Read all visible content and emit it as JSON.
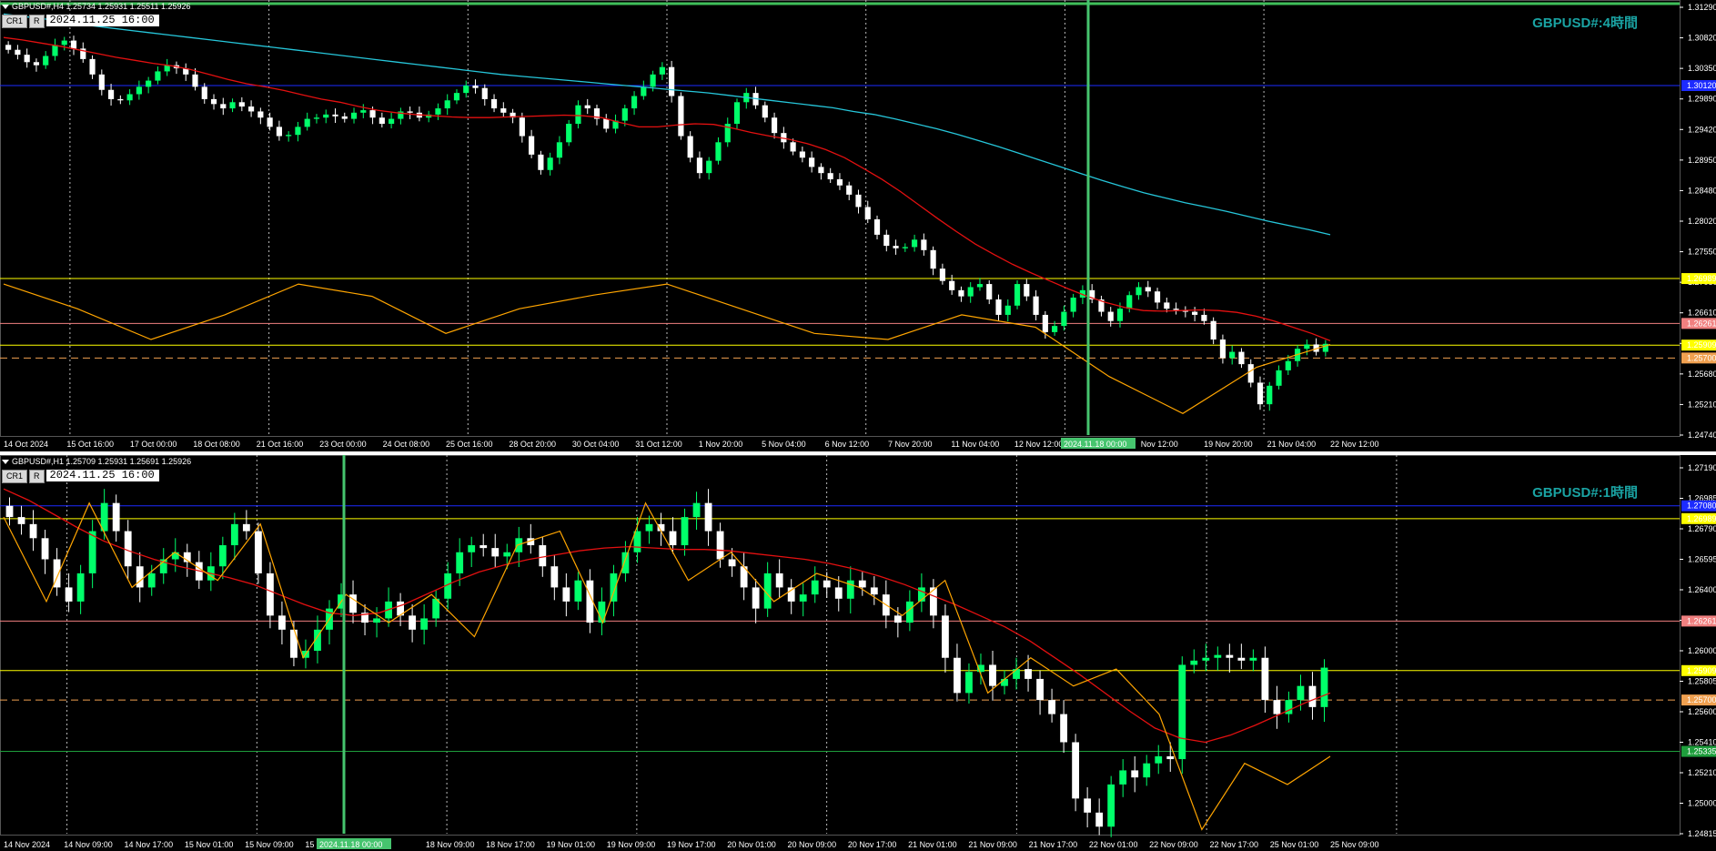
{
  "colors": {
    "background": "#000000",
    "axis_text": "#ffffff",
    "bull": "#00ff6a",
    "bear": "#ffffff",
    "ma_red": "#e31010",
    "ma_cyan": "#26c6da",
    "zigzag": "#ffa500",
    "blue_line": "#1c2bff",
    "yellow_line": "#ffff00",
    "pink_line": "#f08080",
    "orange_dash": "#f0a050",
    "green_line": "#1e9e3c",
    "crosshair": "#46c46e",
    "title": "#1aa3a3"
  },
  "panels": [
    {
      "id": "h4",
      "header": "GBPUSD#,H4  1.25734 1.25931 1.25511 1.25926",
      "cr_label": "CR1",
      "r_label": "R",
      "date_value": "2024.11.25 16:00",
      "title": "GBPUSD#:4時間",
      "crosshair_label": "2024.11.18 00:00",
      "chart_data": {
        "type": "candlestick",
        "ylim": [
          1.2445,
          1.3139
        ],
        "y_ticks": [
          "1.31290",
          "1.30820",
          "1.30350",
          "1.29890",
          "1.29420",
          "1.28950",
          "1.28480",
          "1.28020",
          "1.27550",
          "1.27080",
          "1.26610",
          "1.26150",
          "1.25680",
          "1.25210",
          "1.24740"
        ],
        "x_ticks": [
          "14 Oct 2024",
          "15 Oct 16:00",
          "17 Oct 00:00",
          "18 Oct 08:00",
          "21 Oct 16:00",
          "23 Oct 00:00",
          "24 Oct 08:00",
          "25 Oct 16:00",
          "28 Oct 20:00",
          "30 Oct 04:00",
          "31 Oct 12:00",
          "1 Nov 20:00",
          "5 Nov 04:00",
          "6 Nov 12:00",
          "7 Nov 20:00",
          "11 Nov 04:00",
          "12 Nov 12:00",
          "13 Nov 20:00",
          "Nov 12:00",
          "19 Nov 20:00",
          "21 Nov 04:00",
          "22 Nov 12:00"
        ],
        "closes": [
          1.307,
          1.3062,
          1.305,
          1.3045,
          1.306,
          1.3078,
          1.3085,
          1.3072,
          1.3055,
          1.303,
          1.3005,
          1.299,
          1.2988,
          1.2998,
          1.301,
          1.302,
          1.3035,
          1.3045,
          1.304,
          1.303,
          1.301,
          1.299,
          1.2982,
          1.2975,
          1.2985,
          1.2978,
          1.297,
          1.296,
          1.2945,
          1.293,
          1.2932,
          1.2945,
          1.2958,
          1.296,
          1.2965,
          1.2962,
          1.2958,
          1.2968,
          1.2972,
          1.296,
          1.295,
          1.2958,
          1.297,
          1.2968,
          1.296,
          1.2965,
          1.2975,
          1.2988,
          1.3,
          1.3012,
          1.3008,
          1.299,
          1.2975,
          1.2968,
          1.296,
          1.293,
          1.29,
          1.2875,
          1.2895,
          1.292,
          1.295,
          1.298,
          1.2975,
          1.2958,
          1.2942,
          1.2955,
          1.2975,
          1.2995,
          1.301,
          1.303,
          1.3042,
          1.2995,
          1.293,
          1.2895,
          1.287,
          1.289,
          1.292,
          1.295,
          1.2985,
          1.3,
          1.298,
          1.296,
          1.2935,
          1.292,
          1.2905,
          1.2895,
          1.288,
          1.287,
          1.286,
          1.285,
          1.2835,
          1.2815,
          1.2795,
          1.277,
          1.2752,
          1.2748,
          1.275,
          1.2762,
          1.2745,
          1.2715,
          1.2695,
          1.268,
          1.267,
          1.2685,
          1.269,
          1.2665,
          1.264,
          1.2655,
          1.269,
          1.267,
          1.264,
          1.2612,
          1.2622,
          1.2645,
          1.2668,
          1.268,
          1.2665,
          1.2645,
          1.263,
          1.265,
          1.2672,
          1.2685,
          1.2678,
          1.266,
          1.265,
          1.2648,
          1.2645,
          1.264,
          1.263,
          1.26,
          1.257,
          1.258,
          1.256,
          1.253,
          1.2495,
          1.2525,
          1.255,
          1.2565,
          1.2585,
          1.2592,
          1.258,
          1.2593
        ],
        "series": [
          {
            "name": "",
            "color": "#e31010",
            "values": [
              1.309,
              1.3086,
              1.3081,
              1.3076,
              1.307,
              1.3064,
              1.3058,
              1.3053,
              1.3048,
              1.3044,
              1.3038,
              1.303,
              1.3022,
              1.3015,
              1.301,
              1.3004,
              1.2997,
              1.299,
              1.2985,
              1.2978,
              1.2972,
              1.2968,
              1.2965,
              1.2963,
              1.2961,
              1.296,
              1.296,
              1.2961,
              1.2962,
              1.2963,
              1.2964,
              1.2963,
              1.296,
              1.2952,
              1.2945,
              1.2945,
              1.2948,
              1.295,
              1.2949,
              1.2943,
              1.2936,
              1.293,
              1.2925,
              1.2918,
              1.2908,
              1.2895,
              1.2878,
              1.286,
              1.284,
              1.2818,
              1.2796,
              1.2775,
              1.2755,
              1.2738,
              1.2722,
              1.2708,
              1.2695,
              1.2682,
              1.267,
              1.266,
              1.2652,
              1.2647,
              1.2646,
              1.2647,
              1.2648,
              1.2647,
              1.2644,
              1.2638,
              1.263,
              1.262,
              1.261,
              1.2598
            ]
          },
          {
            "name": "",
            "color": "#26c6da",
            "values": [
              1.3128,
              1.3124,
              1.312,
              1.3115,
              1.311,
              1.3106,
              1.3102,
              1.3098,
              1.3094,
              1.309,
              1.3086,
              1.3082,
              1.3078,
              1.3074,
              1.307,
              1.3066,
              1.3062,
              1.3058,
              1.3054,
              1.305,
              1.3046,
              1.3042,
              1.3038,
              1.3034,
              1.303,
              1.3027,
              1.3024,
              1.3021,
              1.3018,
              1.3015,
              1.3012,
              1.3009,
              1.3006,
              1.3003,
              1.3,
              1.2996,
              1.2992,
              1.2988,
              1.2984,
              1.298,
              1.2976,
              1.297,
              1.2965,
              1.2958,
              1.295,
              1.2942,
              1.2933,
              1.2923,
              1.2913,
              1.2902,
              1.2891,
              1.288,
              1.2869,
              1.2858,
              1.2848,
              1.2838,
              1.283,
              1.2822,
              1.2815,
              1.2808,
              1.28,
              1.2792,
              1.2785,
              1.2778,
              1.277
            ]
          },
          {
            "name": "",
            "color": "#ffa500",
            "values": [
              1.269,
              1.265,
              1.26,
              1.264,
              1.269,
              1.267,
              1.261,
              1.265,
              1.2672,
              1.269,
              1.265,
              1.261,
              1.26,
              1.264,
              1.262,
              1.254,
              1.248,
              1.2555,
              1.2592
            ]
          }
        ],
        "levels": [
          {
            "label": "1.30120",
            "value": 1.3012,
            "color": "#1c2bff"
          },
          {
            "label": "1.26989",
            "value": 1.26989,
            "color": "#ffff00"
          },
          {
            "label": "1.26261",
            "value": 1.26261,
            "color": "#f08080"
          },
          {
            "label": "1.25909",
            "value": 1.25909,
            "color": "#ffff00"
          },
          {
            "label": "1.25700",
            "value": 1.257,
            "color": "#f0a050"
          }
        ],
        "grid": true,
        "legend": "none"
      }
    },
    {
      "id": "h1",
      "header": "GBPUSD#,H1  1.25709 1.25931 1.25691 1.25926",
      "cr_label": "CR1",
      "r_label": "R",
      "date_value": "2024.11.25  16:00",
      "title": "GBPUSD#:1時間",
      "crosshair_label": "2024.11.18 00:00",
      "chart_data": {
        "type": "candlestick",
        "ylim": [
          1.2475,
          1.2735
        ],
        "y_ticks": [
          "1.27190",
          "1.26985",
          "1.26790",
          "1.26595",
          "1.26400",
          "1.26200",
          "1.26000",
          "1.25805",
          "1.25600",
          "1.25410",
          "1.25210",
          "1.25000",
          "1.24815"
        ],
        "x_ticks": [
          "14 Nov 2024",
          "14 Nov 09:00",
          "14 Nov 17:00",
          "15 Nov 01:00",
          "15 Nov 09:00",
          "15 N",
          "01:00",
          "18 Nov 09:00",
          "18 Nov 17:00",
          "19 Nov 01:00",
          "19 Nov 09:00",
          "19 Nov 17:00",
          "20 Nov 01:00",
          "20 Nov 09:00",
          "20 Nov 17:00",
          "21 Nov 01:00",
          "21 Nov 09:00",
          "21 Nov 17:00",
          "22 Nov 01:00",
          "22 Nov 09:00",
          "22 Nov 17:00",
          "25 Nov 01:00",
          "25 Nov 09:00"
        ],
        "closes": [
          1.27,
          1.2695,
          1.2685,
          1.267,
          1.265,
          1.264,
          1.266,
          1.269,
          1.271,
          1.269,
          1.2665,
          1.265,
          1.266,
          1.267,
          1.2675,
          1.2668,
          1.2655,
          1.2665,
          1.268,
          1.2695,
          1.269,
          1.266,
          1.263,
          1.262,
          1.26,
          1.2605,
          1.262,
          1.2635,
          1.2645,
          1.2632,
          1.2625,
          1.2628,
          1.264,
          1.263,
          1.262,
          1.2628,
          1.2642,
          1.266,
          1.2675,
          1.268,
          1.2678,
          1.2672,
          1.2675,
          1.2685,
          1.268,
          1.2665,
          1.265,
          1.264,
          1.2655,
          1.2625,
          1.264,
          1.266,
          1.2675,
          1.269,
          1.2695,
          1.269,
          1.268,
          1.27,
          1.271,
          1.269,
          1.267,
          1.2665,
          1.265,
          1.2635,
          1.266,
          1.265,
          1.264,
          1.2645,
          1.2655,
          1.265,
          1.2642,
          1.2655,
          1.265,
          1.2645,
          1.263,
          1.2625,
          1.264,
          1.265,
          1.263,
          1.26,
          1.2575,
          1.259,
          1.2595,
          1.258,
          1.2585,
          1.2592,
          1.2585,
          1.257,
          1.256,
          1.254,
          1.25,
          1.249,
          1.248,
          1.251,
          1.252,
          1.2515,
          1.2525,
          1.253,
          1.2528,
          1.2595,
          1.2598,
          1.26,
          1.2602,
          1.26,
          1.2598,
          1.26,
          1.257,
          1.256,
          1.257,
          1.258,
          1.2565,
          1.2593
        ],
        "series": [
          {
            "name": "",
            "color": "#e31010",
            "values": [
              1.272,
              1.2712,
              1.2702,
              1.2692,
              1.2683,
              1.2676,
              1.267,
              1.2665,
              1.2661,
              1.2657,
              1.2652,
              1.2645,
              1.2638,
              1.2632,
              1.263,
              1.2632,
              1.2638,
              1.2646,
              1.2654,
              1.2661,
              1.2666,
              1.267,
              1.2673,
              1.2676,
              1.2678,
              1.2679,
              1.2678,
              1.2677,
              1.2677,
              1.2676,
              1.2674,
              1.2672,
              1.267,
              1.2667,
              1.2663,
              1.2658,
              1.2652,
              1.2645,
              1.2638,
              1.263,
              1.2622,
              1.2612,
              1.26,
              1.2588,
              1.2575,
              1.2562,
              1.255,
              1.2543,
              1.254,
              1.2545,
              1.2552,
              1.256,
              1.2568,
              1.2575
            ]
          },
          {
            "name": "",
            "color": "#ffa500",
            "values": [
              1.27,
              1.264,
              1.271,
              1.265,
              1.2675,
              1.2655,
              1.2695,
              1.26,
              1.2645,
              1.2625,
              1.2645,
              1.2615,
              1.268,
              1.269,
              1.2625,
              1.271,
              1.2655,
              1.2675,
              1.264,
              1.266,
              1.265,
              1.263,
              1.2655,
              1.2575,
              1.26,
              1.258,
              1.2592,
              1.256,
              1.2478,
              1.2525,
              1.251,
              1.253
            ]
          }
        ],
        "levels": [
          {
            "label": "1.27080",
            "value": 1.2708,
            "color": "#1c2bff"
          },
          {
            "label": "1.26989",
            "value": 1.26989,
            "color": "#ffff00"
          },
          {
            "label": "1.26261",
            "value": 1.26261,
            "color": "#f08080"
          },
          {
            "label": "1.25909",
            "value": 1.25909,
            "color": "#ffff00"
          },
          {
            "label": "1.25700",
            "value": 1.257,
            "color": "#f0a050"
          },
          {
            "label": "1.25335",
            "value": 1.25335,
            "color": "#1e9e3c"
          }
        ],
        "grid": true,
        "legend": "none"
      }
    }
  ]
}
